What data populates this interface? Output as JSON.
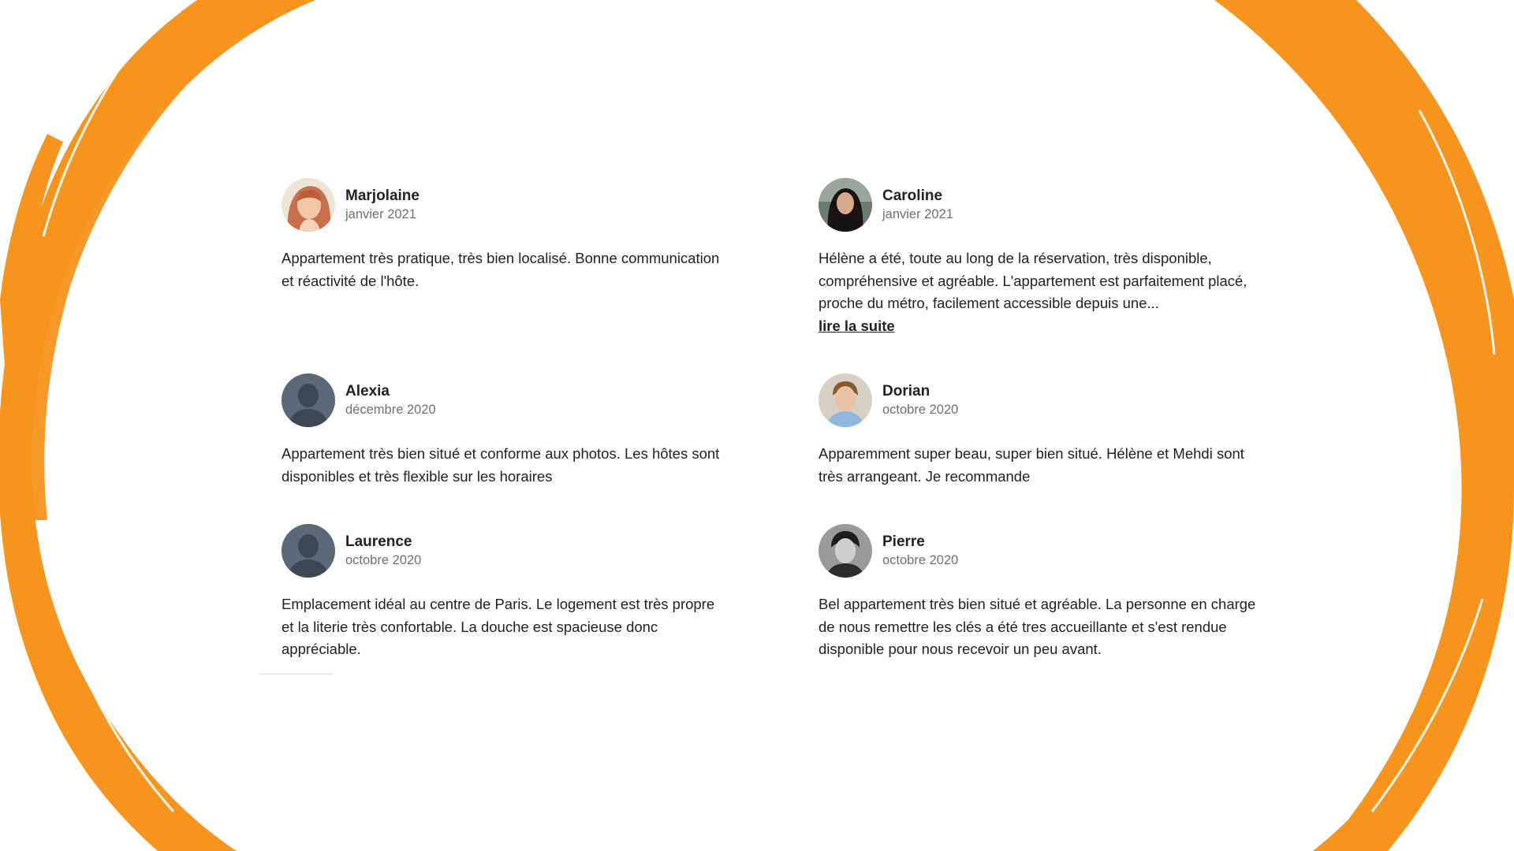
{
  "reviews": [
    {
      "name": "Marjolaine",
      "date": "janvier 2021",
      "text": "Appartement très pratique, très bien localisé. Bonne communication et réactivité de l'hôte.",
      "avatar": "photo-woman-red-hair"
    },
    {
      "name": "Caroline",
      "date": "janvier 2021",
      "text": "Hélène a été, toute au long de la réservation, très disponible, compréhensive et agréable. L'appartement est parfaitement placé, proche du métro, facilement accessible depuis une...",
      "more": "lire la suite",
      "avatar": "photo-woman-dark-hair"
    },
    {
      "name": "Alexia",
      "date": "décembre 2020",
      "text": "Appartement très bien situé et conforme aux photos. Les hôtes sont disponibles et très flexible sur les horaires",
      "avatar": "default-user-icon"
    },
    {
      "name": "Dorian",
      "date": "octobre 2020",
      "text": "Apparemment super beau, super bien situé. Hélène et Mehdi sont très arrangeant. Je recommande",
      "avatar": "photo-young-man"
    },
    {
      "name": "Laurence",
      "date": "octobre 2020",
      "text": "Emplacement idéal au centre de Paris. Le logement est très propre et la literie très confortable. La douche est spacieuse donc appréciable.",
      "avatar": "default-user-icon"
    },
    {
      "name": "Pierre",
      "date": "octobre 2020",
      "text": "Bel appartement très bien situé et agréable. La personne en charge de nous remettre les clés a été tres accueillante et s'est rendue disponible pour nous recevoir un peu avant.",
      "avatar": "photo-man-bw"
    }
  ],
  "colors": {
    "brush": "#F7941D",
    "text": "#222222",
    "muted": "#717171",
    "default_avatar": "#5B6876"
  }
}
